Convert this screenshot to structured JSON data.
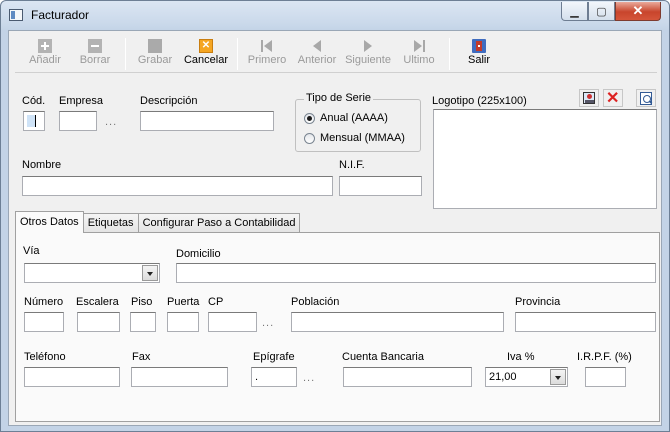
{
  "window": {
    "title": "Facturador",
    "minimize_glyph": "▁",
    "maximize_glyph": "▢",
    "close_glyph": "✕"
  },
  "toolbar": {
    "add_label": "Añadir",
    "delete_label": "Borrar",
    "save_label": "Grabar",
    "cancel_label": "Cancelar",
    "first_label": "Primero",
    "prev_label": "Anterior",
    "next_label": "Siguiente",
    "last_label": "Ultimo",
    "exit_label": "Salir"
  },
  "form": {
    "cod_label": "Cód.",
    "empresa_label": "Empresa",
    "empresa_lookup": "...",
    "descripcion_label": "Descripción",
    "nombre_label": "Nombre",
    "nif_label": "N.I.F.",
    "logo_label": "Logotipo (225x100)"
  },
  "serie": {
    "legend": "Tipo de Serie",
    "annual_label": "Anual (AAAA)",
    "monthly_label": "Mensual (MMAA)",
    "selected": "annual"
  },
  "tabs": [
    {
      "label": "Otros Datos",
      "active": true
    },
    {
      "label": "Etiquetas",
      "active": false
    },
    {
      "label": "Configurar Paso a Contabilidad",
      "active": false
    }
  ],
  "other": {
    "via_label": "Vía",
    "via_value": "",
    "domicilio_label": "Domicilio",
    "numero_label": "Número",
    "escalera_label": "Escalera",
    "piso_label": "Piso",
    "puerta_label": "Puerta",
    "cp_label": "CP",
    "cp_lookup": "...",
    "poblacion_label": "Población",
    "provincia_label": "Provincia",
    "telefono_label": "Teléfono",
    "fax_label": "Fax",
    "epigrafe_label": "Epígrafe",
    "epigrafe_value": ".",
    "epigrafe_lookup": "...",
    "cuenta_label": "Cuenta Bancaria",
    "iva_label": "Iva %",
    "iva_value": "21,00",
    "irpf_label": "I.R.P.F. (%)"
  }
}
